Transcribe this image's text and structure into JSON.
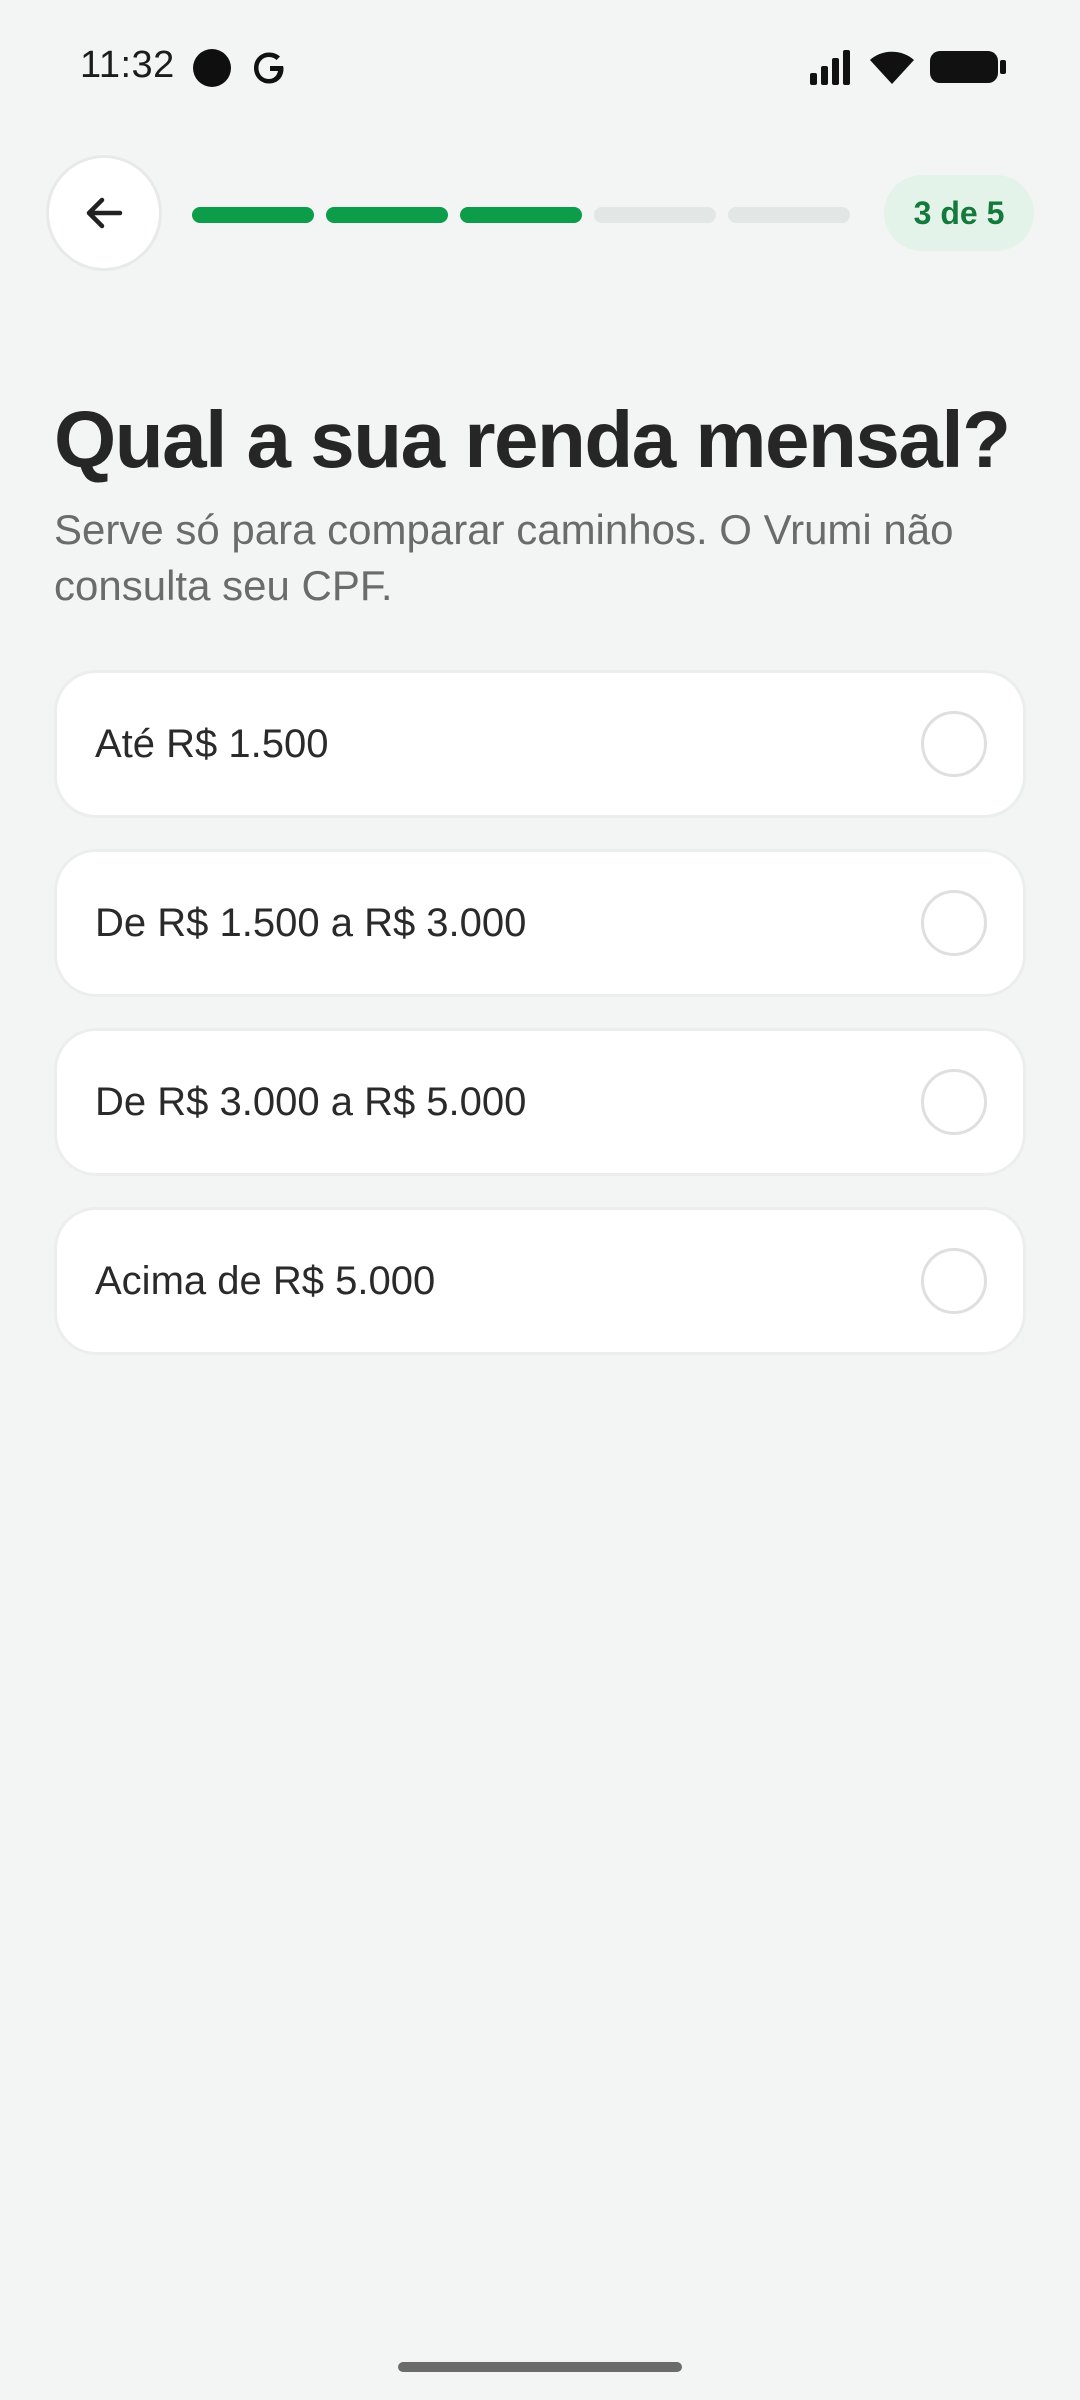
{
  "status_bar": {
    "time": "11:32",
    "notification_icons": [
      "circle-notification-icon",
      "google-g-icon"
    ],
    "system_icons": [
      "signal-icon",
      "wifi-icon",
      "battery-icon"
    ]
  },
  "header": {
    "back_icon": "arrow-left-icon",
    "progress": {
      "current": 3,
      "total": 5
    },
    "step_label": "3 de 5"
  },
  "question": {
    "title": "Qual a sua renda mensal?",
    "subtitle": "Serve só para comparar caminhos. O Vrumi não consulta seu CPF."
  },
  "options": [
    {
      "label": "Até R$ 1.500",
      "selected": false
    },
    {
      "label": "De R$ 1.500 a R$ 3.000",
      "selected": false
    },
    {
      "label": "De R$ 3.000 a R$ 5.000",
      "selected": false
    },
    {
      "label": "Acima de R$ 5.000",
      "selected": false
    }
  ],
  "colors": {
    "accent": "#0c9c4a",
    "progress_inactive": "#e2e6e4",
    "pill_background": "#e3f3e9",
    "pill_text": "#137a3c",
    "background": "#f3f5f4"
  }
}
